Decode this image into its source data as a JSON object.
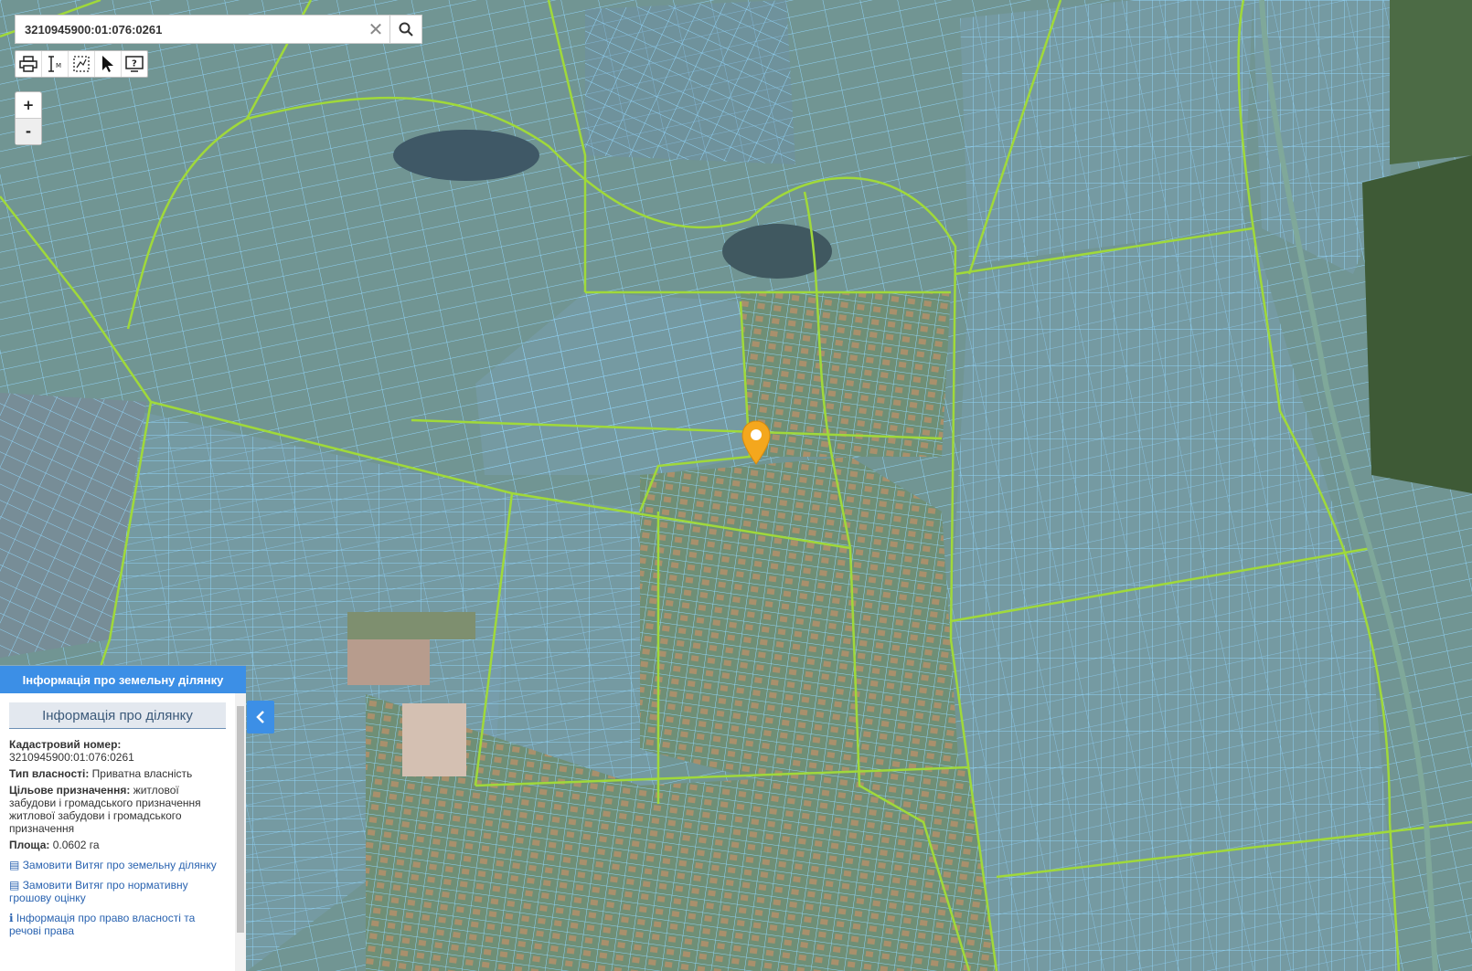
{
  "search": {
    "value": "3210945900:01:076:0261"
  },
  "toolbar": {
    "tools": [
      {
        "icon": "print-icon"
      },
      {
        "icon": "measure-icon"
      },
      {
        "icon": "select-area-icon"
      },
      {
        "icon": "cursor-icon"
      },
      {
        "icon": "help-screen-icon"
      }
    ]
  },
  "zoom": {
    "in_label": "+",
    "out_label": "-"
  },
  "panel": {
    "header": "Інформація про земельну ділянку",
    "subheader": "Інформація про ділянку",
    "cadastral_label": "Кадастровий номер:",
    "cadastral_value": "3210945900:01:076:0261",
    "ownership_label": "Тип власності:",
    "ownership_value": "Приватна власність",
    "purpose_label": "Цільове призначення:",
    "purpose_value": "житлової забудови і громадського призначення житлової забудови і громадського призначення",
    "area_label": "Площа:",
    "area_value": "0.0602 га",
    "link1": "Замовити Витяг про земельну ділянку",
    "link2": "Замовити Витяг про нормативну грошову оцінку",
    "link3": "Інформація про право власності та речові права"
  },
  "colors": {
    "parcel_outline": "#7fc8f0",
    "boundary_line": "#9bd63a",
    "marker": "#f4a71d",
    "panel_header": "#3c8fe6"
  }
}
